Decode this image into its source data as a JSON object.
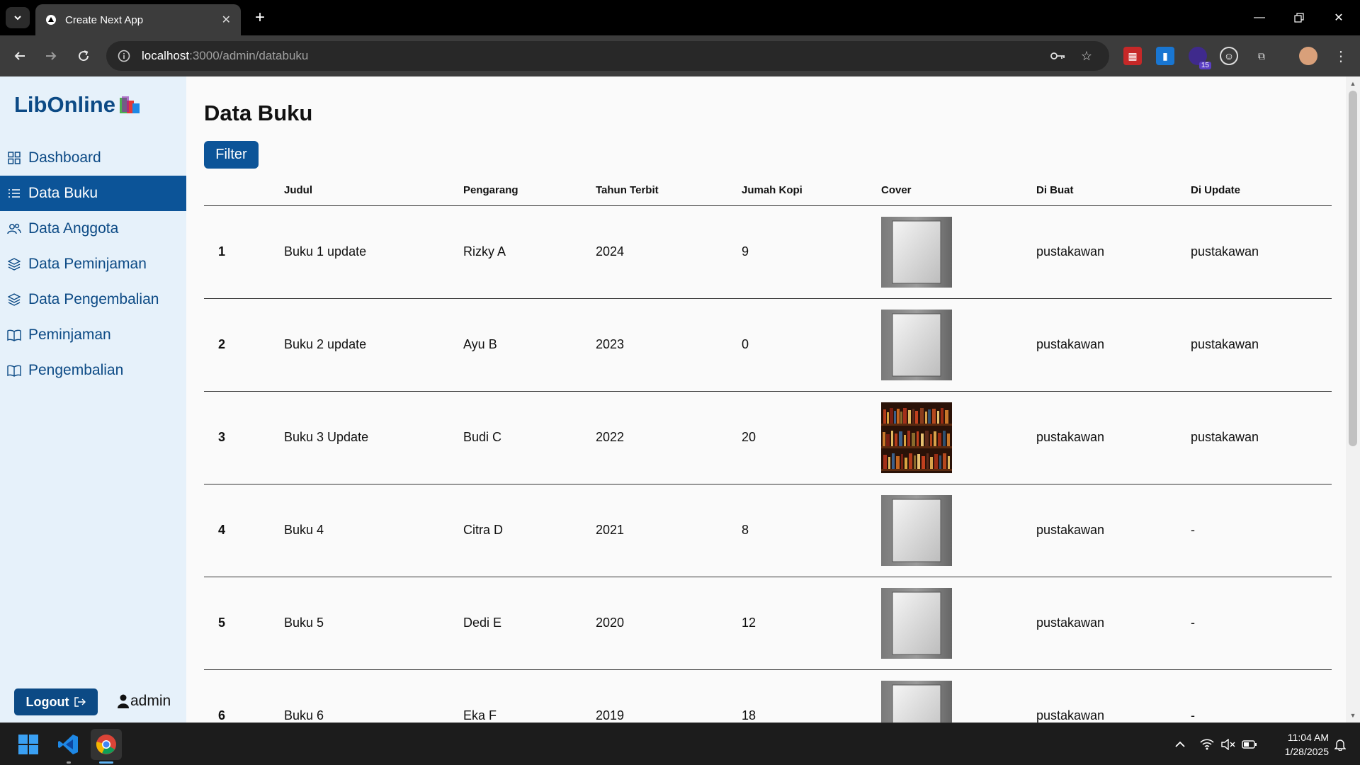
{
  "browser": {
    "tab_title": "Create Next App",
    "url_host": "localhost",
    "url_rest": ":3000/admin/databuku",
    "extension_badge": "15"
  },
  "sidebar": {
    "logo": "LibOnline",
    "items": [
      {
        "label": "Dashboard",
        "icon": "grid-icon"
      },
      {
        "label": "Data Buku",
        "icon": "list-icon",
        "active": true
      },
      {
        "label": "Data Anggota",
        "icon": "users-icon"
      },
      {
        "label": "Data Peminjaman",
        "icon": "layers-icon"
      },
      {
        "label": "Data Pengembalian",
        "icon": "layers-icon"
      },
      {
        "label": "Peminjaman",
        "icon": "book-open-icon"
      },
      {
        "label": "Pengembalian",
        "icon": "book-open-icon"
      }
    ],
    "logout_label": "Logout",
    "username": "admin"
  },
  "main": {
    "title": "Data Buku",
    "filter_label": "Filter",
    "columns": [
      "",
      "Judul",
      "Pengarang",
      "Tahun Terbit",
      "Jumah Kopi",
      "Cover",
      "Di Buat",
      "Di Update"
    ],
    "rows": [
      {
        "no": "1",
        "judul": "Buku 1 update",
        "pengarang": "Rizky A",
        "tahun": "2024",
        "kopi": "9",
        "cover": "placeholder",
        "dibuat": "pustakawan",
        "diupdate": "pustakawan"
      },
      {
        "no": "2",
        "judul": "Buku 2 update",
        "pengarang": "Ayu B",
        "tahun": "2023",
        "kopi": "0",
        "cover": "placeholder",
        "dibuat": "pustakawan",
        "diupdate": "pustakawan"
      },
      {
        "no": "3",
        "judul": "Buku 3 Update",
        "pengarang": "Budi C",
        "tahun": "2022",
        "kopi": "20",
        "cover": "bookshelf",
        "dibuat": "pustakawan",
        "diupdate": "pustakawan"
      },
      {
        "no": "4",
        "judul": "Buku 4",
        "pengarang": "Citra D",
        "tahun": "2021",
        "kopi": "8",
        "cover": "placeholder",
        "dibuat": "pustakawan",
        "diupdate": "-"
      },
      {
        "no": "5",
        "judul": "Buku 5",
        "pengarang": "Dedi E",
        "tahun": "2020",
        "kopi": "12",
        "cover": "placeholder",
        "dibuat": "pustakawan",
        "diupdate": "-"
      },
      {
        "no": "6",
        "judul": "Buku 6",
        "pengarang": "Eka F",
        "tahun": "2019",
        "kopi": "18",
        "cover": "placeholder",
        "dibuat": "pustakawan",
        "diupdate": "-"
      }
    ]
  },
  "taskbar": {
    "time": "11:04 AM",
    "date": "1/28/2025"
  },
  "colors": {
    "primary": "#0c5498",
    "sidebar_bg": "#e6f1fa",
    "page_bg": "#fafafa"
  }
}
